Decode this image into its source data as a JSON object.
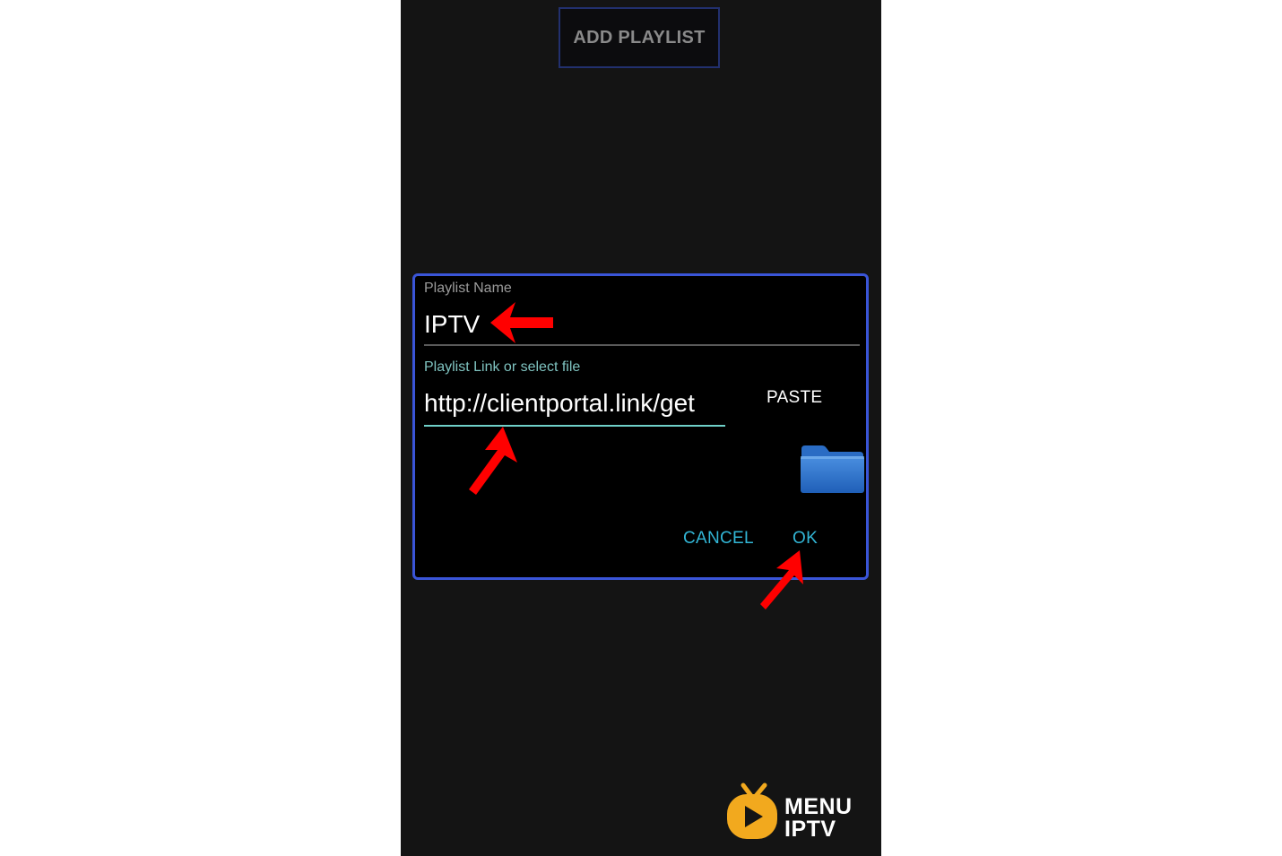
{
  "header": {
    "add_playlist_label": "ADD PLAYLIST"
  },
  "dialog": {
    "name_label": "Playlist Name",
    "name_value": "IPTV",
    "link_label": "Playlist Link or select file",
    "link_value": "http://clientportal.link/get",
    "paste_label": "PASTE",
    "cancel_label": "CANCEL",
    "ok_label": "OK"
  },
  "logo": {
    "line1": "MENU",
    "line2": "IPTV"
  },
  "colors": {
    "accent_border": "#3a55d8",
    "button_text": "#32b6d6",
    "annotation_arrow": "#ff0000",
    "logo_icon": "#f2a91e"
  },
  "icons": {
    "folder": "folder-icon",
    "logo": "tv-play-icon",
    "annotation": "red-arrow-icon"
  }
}
